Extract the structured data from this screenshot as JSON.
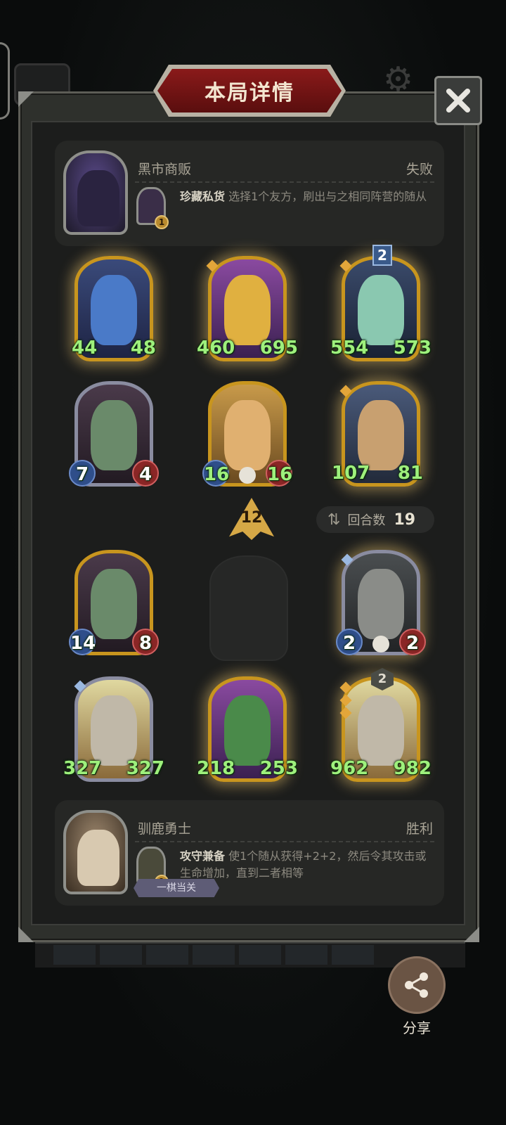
{
  "title": "本局详情",
  "opponent": {
    "name": "黑市商贩",
    "result": "失败",
    "skill_name": "珍藏私货",
    "skill_desc": "选择1个友方，刷出与之相同阵营的随从",
    "skill_level": "1"
  },
  "player": {
    "name": "驯鹿勇士",
    "result": "胜利",
    "skill_name": "攻守兼备",
    "skill_desc": "使1个随从获得+2+2，然后令其攻击或生命增加，直到二者相等",
    "skill_level": "1",
    "tag": "一棋当关"
  },
  "opponent_board": [
    {
      "atk": "44",
      "hp": "48"
    },
    {
      "atk": "460",
      "hp": "695"
    },
    {
      "atk": "554",
      "hp": "573",
      "badge": "2"
    },
    {
      "atk": "7",
      "hp": "4"
    },
    {
      "atk": "16",
      "hp": "16"
    },
    {
      "atk": "107",
      "hp": "81"
    }
  ],
  "tavern_tier": "12",
  "round": {
    "label": "回合数",
    "value": "19"
  },
  "player_board": [
    {
      "atk": "14",
      "hp": "8"
    },
    {
      "atk": "2",
      "hp": "2"
    },
    {
      "atk": "327",
      "hp": "327"
    },
    {
      "atk": "218",
      "hp": "253"
    },
    {
      "atk": "962",
      "hp": "982",
      "badge": "2"
    }
  ],
  "share_label": "分享"
}
